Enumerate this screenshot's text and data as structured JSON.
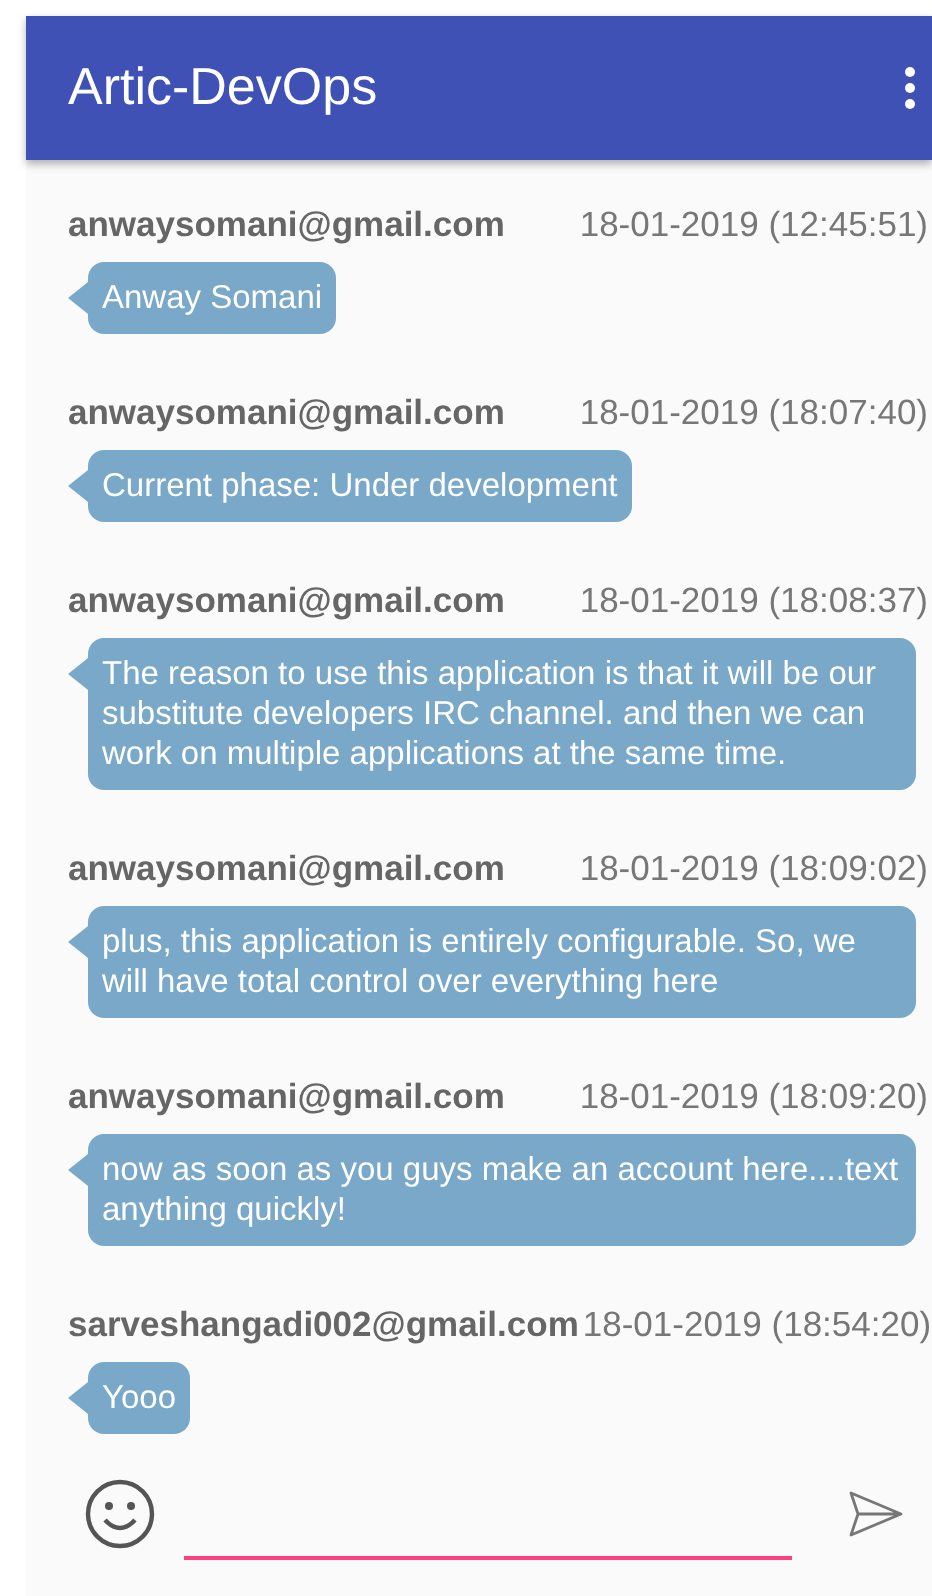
{
  "app_bar": {
    "title": "Artic-DevOps"
  },
  "messages": [
    {
      "sender": "anwaysomani@gmail.com",
      "time": "18-01-2019 (12:45:51)",
      "text": "Anway Somani"
    },
    {
      "sender": "anwaysomani@gmail.com",
      "time": "18-01-2019 (18:07:40)",
      "text": "Current phase: Under development"
    },
    {
      "sender": "anwaysomani@gmail.com",
      "time": "18-01-2019 (18:08:37)",
      "text": "The reason to use this application is that it will be our substitute developers IRC channel. and then we can work on multiple applications at the same time."
    },
    {
      "sender": "anwaysomani@gmail.com",
      "time": "18-01-2019 (18:09:02)",
      "text": "plus, this application is entirely configurable. So, we will have total control over everything here"
    },
    {
      "sender": "anwaysomani@gmail.com",
      "time": "18-01-2019 (18:09:20)",
      "text": "now as soon as you guys make an account here....text anything quickly!"
    },
    {
      "sender": "sarveshangadi002@gmail.com",
      "time": "18-01-2019 (18:54:20)",
      "text": "Yooo"
    }
  ]
}
